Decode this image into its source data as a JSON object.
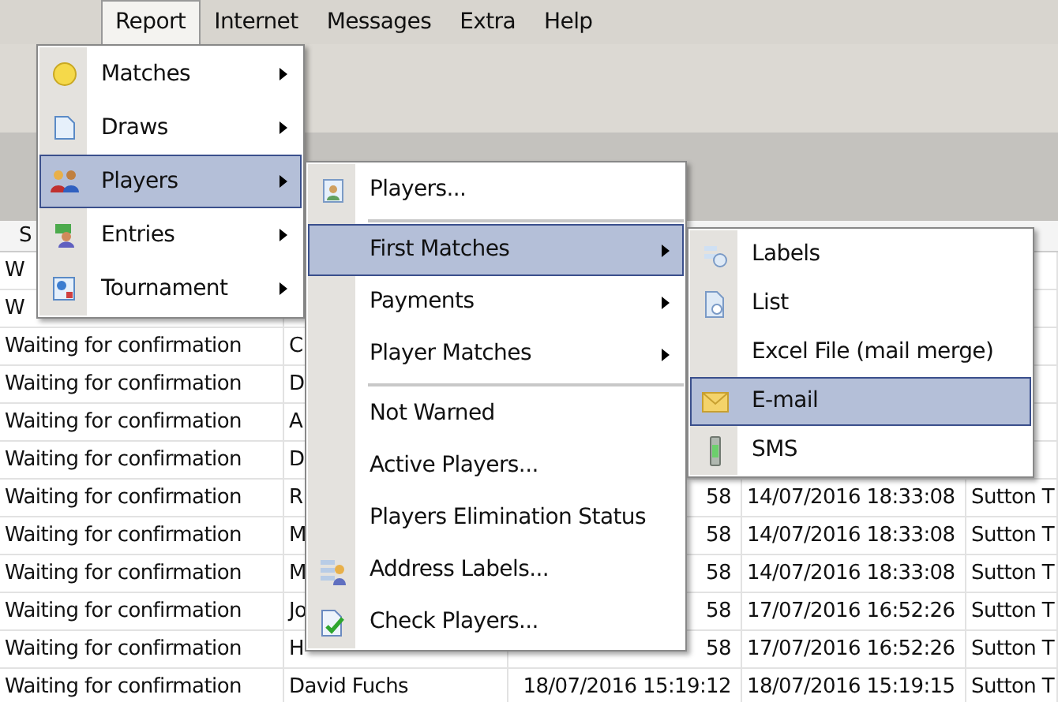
{
  "menubar": [
    {
      "label": "Report",
      "selected": true
    },
    {
      "label": "Internet",
      "selected": false
    },
    {
      "label": "Messages",
      "selected": false
    },
    {
      "label": "Extra",
      "selected": false
    },
    {
      "label": "Help",
      "selected": false
    }
  ],
  "table": {
    "header": "S",
    "rows": [
      {
        "column_1": "W",
        "column_2": "",
        "column_3": "",
        "column_4": "",
        "column_5": ""
      },
      {
        "column_1": "W",
        "column_2": "",
        "column_3": "",
        "column_4": "",
        "column_5": ""
      },
      {
        "column_1": "Waiting for confirmation",
        "column_2": "C",
        "column_3": "",
        "column_4": "",
        "column_5": ""
      },
      {
        "column_1": "Waiting for confirmation",
        "column_2": "D",
        "column_3": "",
        "column_4": "",
        "column_5": ""
      },
      {
        "column_1": "Waiting for confirmation",
        "column_2": "A",
        "column_3": "",
        "column_4": "",
        "column_5": ""
      },
      {
        "column_1": "Waiting for confirmation",
        "column_2": "D",
        "column_3": "",
        "column_4": "",
        "column_5": ""
      },
      {
        "column_1": "Waiting for confirmation",
        "column_2": "R",
        "column_3": "58",
        "column_4": "14/07/2016 18:33:08",
        "column_5": "Sutton T"
      },
      {
        "column_1": "Waiting for confirmation",
        "column_2": "M",
        "column_3": "58",
        "column_4": "14/07/2016 18:33:08",
        "column_5": "Sutton T"
      },
      {
        "column_1": "Waiting for confirmation",
        "column_2": "M",
        "column_3": "58",
        "column_4": "14/07/2016 18:33:08",
        "column_5": "Sutton T"
      },
      {
        "column_1": "Waiting for confirmation",
        "column_2": "Jo",
        "column_3": "58",
        "column_4": "17/07/2016 16:52:26",
        "column_5": "Sutton T"
      },
      {
        "column_1": "Waiting for confirmation",
        "column_2": "H",
        "column_3": "58",
        "column_4": "17/07/2016 16:52:26",
        "column_5": "Sutton T"
      },
      {
        "column_1": "Waiting for confirmation",
        "column_2": "David Fuchs",
        "column_3": "18/07/2016 15:19:12",
        "column_4": "18/07/2016 15:19:15",
        "column_5": "Sutton T"
      }
    ]
  },
  "report_menu": [
    {
      "label": "Matches",
      "submenu": true,
      "selected": false
    },
    {
      "label": "Draws",
      "submenu": true,
      "selected": false
    },
    {
      "label": "Players",
      "submenu": true,
      "selected": true
    },
    {
      "label": "Entries",
      "submenu": true,
      "selected": false
    },
    {
      "label": "Tournament",
      "submenu": true,
      "selected": false
    }
  ],
  "players_menu": [
    {
      "kind": "item",
      "label": "Players...",
      "submenu": false,
      "selected": false
    },
    {
      "kind": "separator"
    },
    {
      "kind": "item",
      "label": "First Matches",
      "submenu": true,
      "selected": true
    },
    {
      "kind": "item",
      "label": "Payments",
      "submenu": true,
      "selected": false
    },
    {
      "kind": "item",
      "label": "Player Matches",
      "submenu": true,
      "selected": false
    },
    {
      "kind": "separator"
    },
    {
      "kind": "item",
      "label": "Not Warned",
      "submenu": false,
      "selected": false
    },
    {
      "kind": "item",
      "label": "Active Players...",
      "submenu": false,
      "selected": false
    },
    {
      "kind": "item",
      "label": "Players Elimination Status",
      "submenu": false,
      "selected": false
    },
    {
      "kind": "item",
      "label": "Address Labels...",
      "submenu": false,
      "selected": false
    },
    {
      "kind": "item",
      "label": "Check Players...",
      "submenu": false,
      "selected": false
    }
  ],
  "first_matches_menu": [
    {
      "label": "Labels",
      "selected": false
    },
    {
      "label": "List",
      "selected": false
    },
    {
      "label": "Excel File (mail merge)",
      "selected": false
    },
    {
      "label": "E-mail",
      "selected": true
    },
    {
      "label": "SMS",
      "selected": false
    }
  ]
}
